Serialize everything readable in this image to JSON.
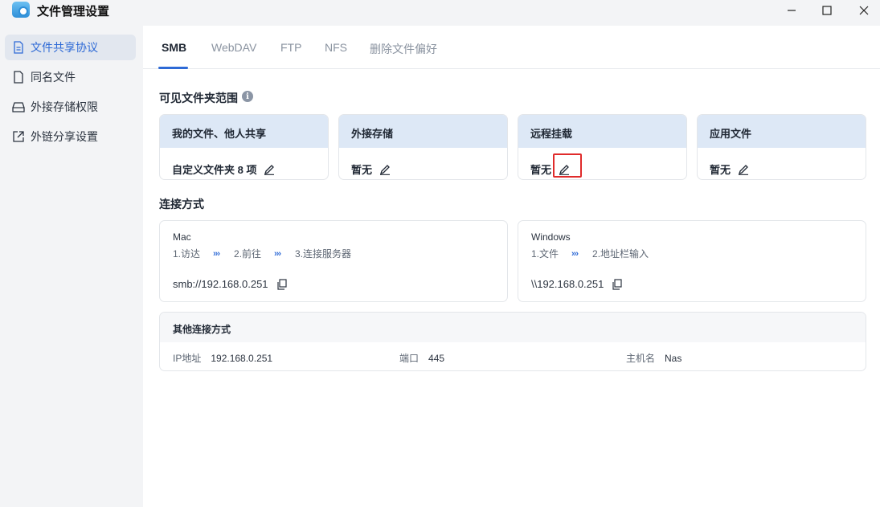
{
  "window": {
    "title": "文件管理设置"
  },
  "sidebar": {
    "items": [
      {
        "label": "文件共享协议",
        "icon": "document-icon",
        "active": true
      },
      {
        "label": "同名文件",
        "icon": "file-icon",
        "active": false
      },
      {
        "label": "外接存储权限",
        "icon": "drive-icon",
        "active": false
      },
      {
        "label": "外链分享设置",
        "icon": "share-link-icon",
        "active": false
      }
    ]
  },
  "tabs": [
    {
      "label": "SMB",
      "active": true
    },
    {
      "label": "WebDAV",
      "active": false
    },
    {
      "label": "FTP",
      "active": false
    },
    {
      "label": "NFS",
      "active": false
    },
    {
      "label": "删除文件偏好",
      "active": false
    }
  ],
  "scope": {
    "title": "可见文件夹范围",
    "info_icon": "i",
    "cards": [
      {
        "header": "我的文件、他人共享",
        "value": "自定义文件夹 8 项"
      },
      {
        "header": "外接存储",
        "value": "暂无"
      },
      {
        "header": "远程挂载",
        "value": "暂无"
      },
      {
        "header": "应用文件",
        "value": "暂无"
      }
    ]
  },
  "connection": {
    "title": "连接方式",
    "mac": {
      "name": "Mac",
      "steps": [
        "1.访达",
        "2.前往",
        "3.连接服务器"
      ],
      "arrow": "›››",
      "address": "smb://192.168.0.251"
    },
    "windows": {
      "name": "Windows",
      "steps": [
        "1.文件",
        "2.地址栏输入"
      ],
      "arrow": "›››",
      "address": "\\\\192.168.0.251"
    },
    "other": {
      "title": "其他连接方式",
      "ip_label": "IP地址",
      "ip_value": "192.168.0.251",
      "port_label": "端口",
      "port_value": "445",
      "host_label": "主机名",
      "host_value": "Nas"
    }
  },
  "colors": {
    "accent": "#2e6ad6",
    "highlight": "#e02b2b",
    "card_header": "#dde8f6"
  }
}
